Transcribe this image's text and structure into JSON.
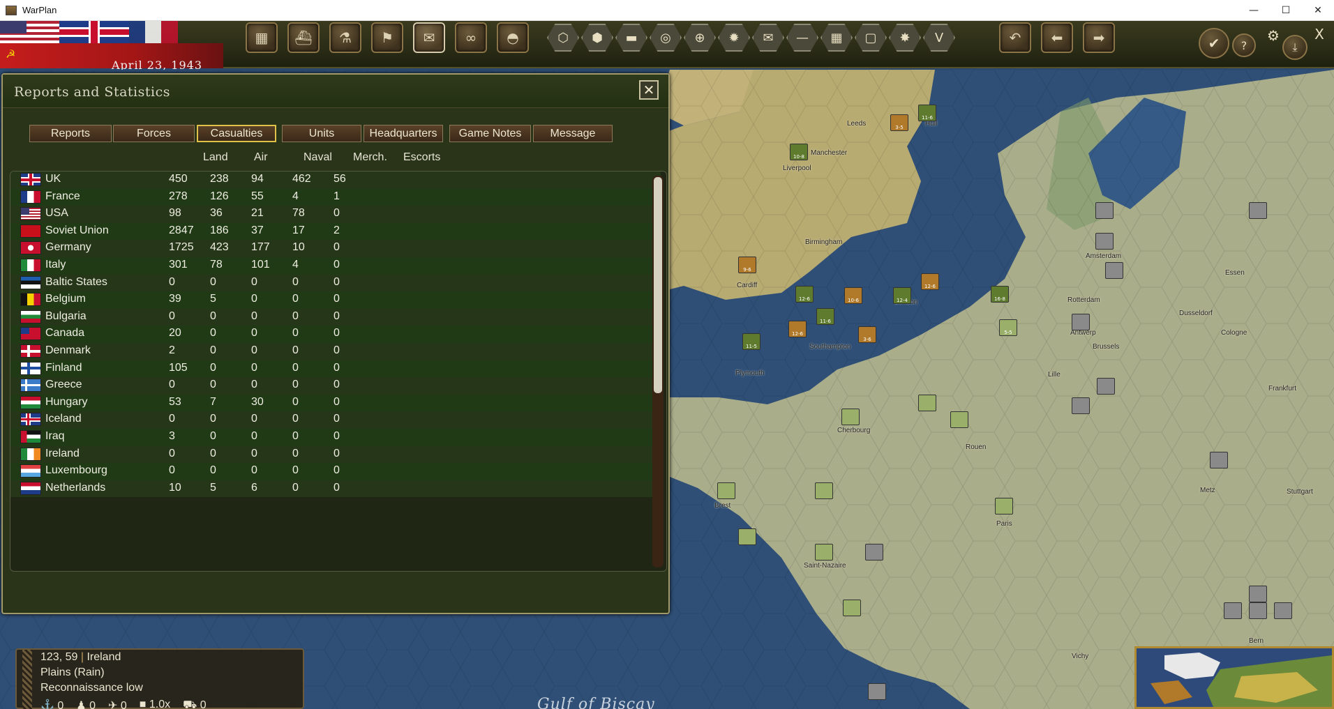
{
  "window": {
    "title": "WarPlan",
    "minimize": "—",
    "maximize": "☐",
    "close": "✕"
  },
  "toolbar": {
    "date": "April 23, 1943",
    "buttons": [
      {
        "name": "production-button",
        "icon": "factory-icon",
        "glyph": "▦"
      },
      {
        "name": "naval-button",
        "icon": "ship-icon",
        "glyph": "⛴"
      },
      {
        "name": "research-button",
        "icon": "microscope-icon",
        "glyph": "⚗"
      },
      {
        "name": "diplomacy-button",
        "icon": "flag-icon",
        "glyph": "⚑"
      },
      {
        "name": "reports-button",
        "icon": "report-icon",
        "glyph": "✉"
      },
      {
        "name": "recon-button",
        "icon": "binoculars-icon",
        "glyph": "∞"
      },
      {
        "name": "units-button",
        "icon": "helmet-icon",
        "glyph": "◓"
      }
    ],
    "hex_buttons": [
      {
        "name": "hex-overlay-button",
        "icon": "hex-icon",
        "glyph": "⬡"
      },
      {
        "name": "supply-overlay-button",
        "icon": "hexes-icon",
        "glyph": "⬢"
      },
      {
        "name": "rail-overlay-button",
        "icon": "train-icon",
        "glyph": "▬"
      },
      {
        "name": "resources-overlay-button",
        "icon": "coins-icon",
        "glyph": "◎"
      },
      {
        "name": "target-overlay-button",
        "icon": "crosshair-icon",
        "glyph": "⊕"
      },
      {
        "name": "weather-overlay-button",
        "icon": "sun-icon",
        "glyph": "✹"
      },
      {
        "name": "mail-overlay-button",
        "icon": "envelope-icon",
        "glyph": "✉"
      },
      {
        "name": "front-overlay-button",
        "icon": "line-icon",
        "glyph": "—"
      },
      {
        "name": "grid-overlay-button",
        "icon": "grid-icon",
        "glyph": "▦"
      },
      {
        "name": "zoc-overlay-button",
        "icon": "square-icon",
        "glyph": "▢"
      },
      {
        "name": "combat-overlay-button",
        "icon": "explosion-icon",
        "glyph": "✸"
      },
      {
        "name": "victory-overlay-button",
        "icon": "victory-icon",
        "glyph": "V"
      }
    ],
    "nav_buttons": [
      {
        "name": "undo-button",
        "icon": "undo-icon",
        "glyph": "↶"
      },
      {
        "name": "previous-button",
        "icon": "arrow-left-icon",
        "glyph": "⬅"
      },
      {
        "name": "next-button",
        "icon": "arrow-right-icon",
        "glyph": "➡"
      }
    ],
    "right_buttons": {
      "end_turn": "✔",
      "help": "?",
      "settings": "⚙",
      "save": "⤓",
      "exit": "X"
    }
  },
  "panel": {
    "title": "Reports and Statistics",
    "close": "✕",
    "tabs": [
      "Reports",
      "Forces",
      "Casualties",
      "Units",
      "Headquarters",
      "Game Notes",
      "Message"
    ],
    "active_tab": "Casualties",
    "columns": [
      "Land",
      "Air",
      "Naval",
      "Merch.",
      "Escorts"
    ],
    "rows": [
      {
        "country": "UK",
        "flag": "uk",
        "land": "450",
        "air": "238",
        "naval": "94",
        "merch": "462",
        "escorts": "56"
      },
      {
        "country": "France",
        "flag": "france",
        "land": "278",
        "air": "126",
        "naval": "55",
        "merch": "4",
        "escorts": "1"
      },
      {
        "country": "USA",
        "flag": "usa",
        "land": "98",
        "air": "36",
        "naval": "21",
        "merch": "78",
        "escorts": "0"
      },
      {
        "country": "Soviet Union",
        "flag": "soviet",
        "land": "2847",
        "air": "186",
        "naval": "37",
        "merch": "17",
        "escorts": "2"
      },
      {
        "country": "Germany",
        "flag": "germany",
        "land": "1725",
        "air": "423",
        "naval": "177",
        "merch": "10",
        "escorts": "0"
      },
      {
        "country": "Italy",
        "flag": "italy",
        "land": "301",
        "air": "78",
        "naval": "101",
        "merch": "4",
        "escorts": "0"
      },
      {
        "country": "Baltic States",
        "flag": "baltic",
        "land": "0",
        "air": "0",
        "naval": "0",
        "merch": "0",
        "escorts": "0"
      },
      {
        "country": "Belgium",
        "flag": "belgium",
        "land": "39",
        "air": "5",
        "naval": "0",
        "merch": "0",
        "escorts": "0"
      },
      {
        "country": "Bulgaria",
        "flag": "bulgaria",
        "land": "0",
        "air": "0",
        "naval": "0",
        "merch": "0",
        "escorts": "0"
      },
      {
        "country": "Canada",
        "flag": "canada",
        "land": "20",
        "air": "0",
        "naval": "0",
        "merch": "0",
        "escorts": "0"
      },
      {
        "country": "Denmark",
        "flag": "denmark",
        "land": "2",
        "air": "0",
        "naval": "0",
        "merch": "0",
        "escorts": "0"
      },
      {
        "country": "Finland",
        "flag": "finland",
        "land": "105",
        "air": "0",
        "naval": "0",
        "merch": "0",
        "escorts": "0"
      },
      {
        "country": "Greece",
        "flag": "greece",
        "land": "0",
        "air": "0",
        "naval": "0",
        "merch": "0",
        "escorts": "0"
      },
      {
        "country": "Hungary",
        "flag": "hungary",
        "land": "53",
        "air": "7",
        "naval": "30",
        "merch": "0",
        "escorts": "0"
      },
      {
        "country": "Iceland",
        "flag": "iceland",
        "land": "0",
        "air": "0",
        "naval": "0",
        "merch": "0",
        "escorts": "0"
      },
      {
        "country": "Iraq",
        "flag": "iraq",
        "land": "3",
        "air": "0",
        "naval": "0",
        "merch": "0",
        "escorts": "0"
      },
      {
        "country": "Ireland",
        "flag": "ireland",
        "land": "0",
        "air": "0",
        "naval": "0",
        "merch": "0",
        "escorts": "0"
      },
      {
        "country": "Luxembourg",
        "flag": "luxembourg",
        "land": "0",
        "air": "0",
        "naval": "0",
        "merch": "0",
        "escorts": "0"
      },
      {
        "country": "Netherlands",
        "flag": "netherlands",
        "land": "10",
        "air": "5",
        "naval": "6",
        "merch": "0",
        "escorts": "0"
      }
    ]
  },
  "map": {
    "cities": [
      "Leeds",
      "Hull",
      "Manchester",
      "Liverpool",
      "Birmingham",
      "Cardiff",
      "London",
      "Southampton",
      "Plymouth",
      "Amsterdam",
      "Rotterdam",
      "Antwerp",
      "Brussels",
      "Lille",
      "Essen",
      "Dusseldorf",
      "Cologne",
      "Frankfurt",
      "Cherbourg",
      "Rouen",
      "Paris",
      "Metz",
      "Stuttgart",
      "Brest",
      "Saint-Nazaire",
      "Vichy",
      "Bern"
    ],
    "sea_label": "Gulf of Biscay"
  },
  "infobox": {
    "coords": "123, 59",
    "region": "Ireland",
    "terrain": "Plains (Rain)",
    "recon": "Reconnaissance low",
    "stats": [
      "0",
      "0",
      "0",
      "1.0x",
      "0"
    ]
  }
}
